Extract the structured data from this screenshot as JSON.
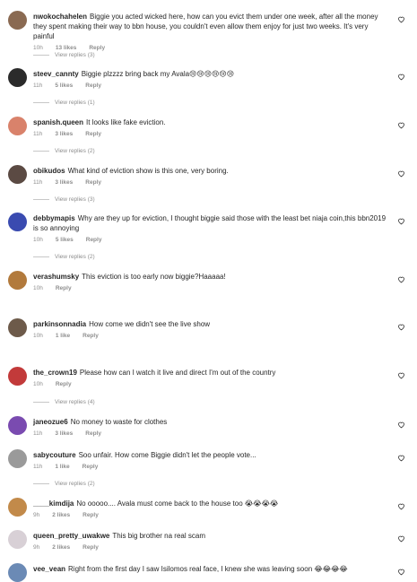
{
  "comments": [
    {
      "user": "nwokochahelen",
      "text": "Biggie you acted wicked here, how can you evict them under one week, after all the money they spent making their way to bbn house, you couldn't even allow them enjoy for just two weeks. It's very painful",
      "time": "10h",
      "likes": "13 likes",
      "reply": "Reply",
      "view_replies": "View replies (3)",
      "avatar_color": "#8a6a52"
    },
    {
      "user": "steev_cannty",
      "text": "Biggie plzzzz bring back my Avala😢😢😢😢😢😢",
      "time": "11h",
      "likes": "5 likes",
      "reply": "Reply",
      "view_replies": "View replies (1)",
      "avatar_color": "#2b2b2b"
    },
    {
      "user": "spanish.queen",
      "text": "It looks like fake eviction.",
      "time": "11h",
      "likes": "3 likes",
      "reply": "Reply",
      "view_replies": "View replies (2)",
      "avatar_color": "#d9826b"
    },
    {
      "user": "obikudos",
      "text": "What kind of eviction show is this one, very boring.",
      "time": "11h",
      "likes": "3 likes",
      "reply": "Reply",
      "view_replies": "View replies (3)",
      "avatar_color": "#5b4a43"
    },
    {
      "user": "debbymapis",
      "text": "Why are they up for eviction, I thought biggie said those with the least bet niaja coin,this bbn2019 is so annoying",
      "time": "10h",
      "likes": "5 likes",
      "reply": "Reply",
      "view_replies": "View replies (2)",
      "avatar_color": "#3a4bb0"
    },
    {
      "user": "verashumsky",
      "text": "This eviction is too early now biggie?Haaaaa!",
      "time": "10h",
      "likes": "",
      "reply": "Reply",
      "view_replies": "",
      "avatar_color": "#b27a3c"
    },
    {
      "user": "parkinsonnadia",
      "text": "How come we didn't see the live show",
      "time": "10h",
      "likes": "1 like",
      "reply": "Reply",
      "view_replies": "",
      "avatar_color": "#6d5a4a"
    },
    {
      "user": "the_crown19",
      "text": "Please how can I watch it live and direct I'm out of the country",
      "time": "10h",
      "likes": "",
      "reply": "Reply",
      "view_replies": "View replies (4)",
      "avatar_color": "#c23a3a"
    },
    {
      "user": "janeozue6",
      "text": "No money to waste for clothes",
      "time": "11h",
      "likes": "3 likes",
      "reply": "Reply",
      "view_replies": "",
      "avatar_color": "#7a4bb0"
    },
    {
      "user": "sabycouture",
      "text": "Soo unfair. How come Biggie didn't let the people vote...",
      "time": "11h",
      "likes": "1 like",
      "reply": "Reply",
      "view_replies": "View replies (2)",
      "avatar_color": "#9a9a9a"
    },
    {
      "user": "____kimdija",
      "text": "No ooooo.... Avala must come back to the house too 😭😭😭😭",
      "time": "9h",
      "likes": "2 likes",
      "reply": "Reply",
      "view_replies": "",
      "avatar_color": "#c28a4a"
    },
    {
      "user": "queen_pretty_uwakwe",
      "text": "This big brother na real scam",
      "time": "9h",
      "likes": "2 likes",
      "reply": "Reply",
      "view_replies": "",
      "avatar_color": "#d8d0d6"
    },
    {
      "user": "vee_vean",
      "text": "Right from the first day I saw Isilomos real face, I knew she was leaving soon 😂😂😂😂",
      "time": "",
      "likes": "",
      "reply": "",
      "view_replies": "",
      "avatar_color": "#6b8ab5"
    }
  ]
}
